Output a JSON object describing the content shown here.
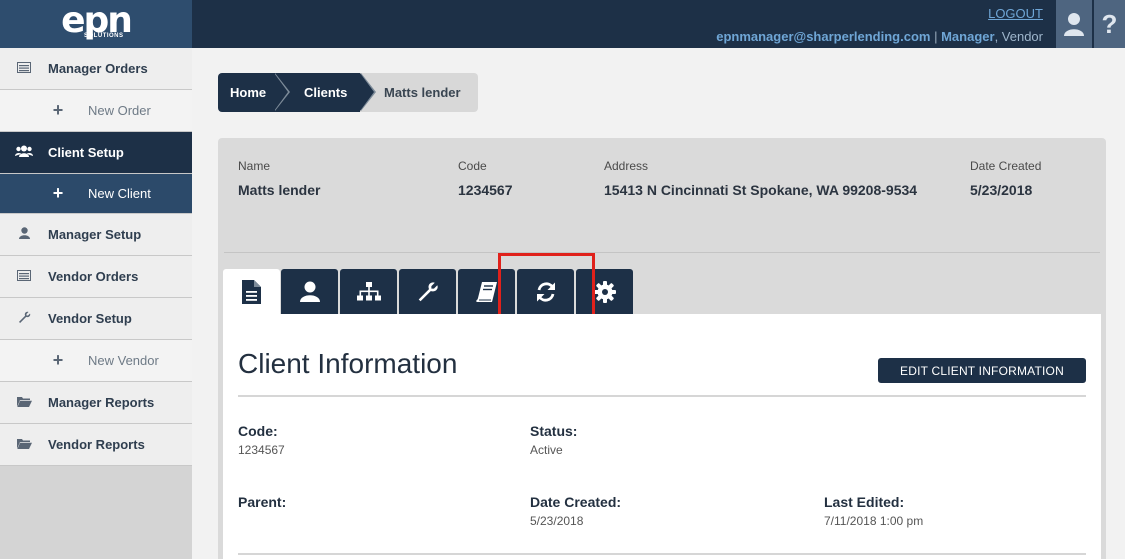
{
  "header": {
    "logo": "epn",
    "logo_sub": "SOLUTIONS",
    "logout": "LOGOUT",
    "email": "epnmanager@sharperlending.com",
    "separator": "|",
    "role": "Manager",
    "vendor": ", Vendor"
  },
  "sidebar": {
    "items": [
      {
        "label": "Manager Orders"
      },
      {
        "label": "New Order"
      },
      {
        "label": "Client Setup"
      },
      {
        "label": "New Client"
      },
      {
        "label": "Manager Setup"
      },
      {
        "label": "Vendor Orders"
      },
      {
        "label": "Vendor Setup"
      },
      {
        "label": "New Vendor"
      },
      {
        "label": "Manager Reports"
      },
      {
        "label": "Vendor Reports"
      }
    ]
  },
  "breadcrumb": [
    "Home",
    "Clients",
    "Matts lender"
  ],
  "client_header": {
    "name_label": "Name",
    "name": "Matts lender",
    "code_label": "Code",
    "code": "1234567",
    "address_label": "Address",
    "address": "15413 N Cincinnati St Spokane, WA 99208-9534",
    "date_label": "Date Created",
    "date": "5/23/2018"
  },
  "tabs": [
    "document-icon",
    "user-icon",
    "hierarchy-icon",
    "wrench-icon",
    "book-icon",
    "refresh-icon",
    "gear-icon"
  ],
  "content": {
    "title": "Client Information",
    "edit_button": "EDIT CLIENT INFORMATION",
    "fields": {
      "code_label": "Code:",
      "code": "1234567",
      "status_label": "Status:",
      "status": "Active",
      "parent_label": "Parent:",
      "parent": "",
      "date_created_label": "Date Created:",
      "date_created": "5/23/2018",
      "last_edited_label": "Last Edited:",
      "last_edited": "7/11/2018 1:00 pm"
    }
  },
  "colors": {
    "navy": "#1d3047",
    "highlight": "#e0211b",
    "link": "#6fa6d6"
  }
}
